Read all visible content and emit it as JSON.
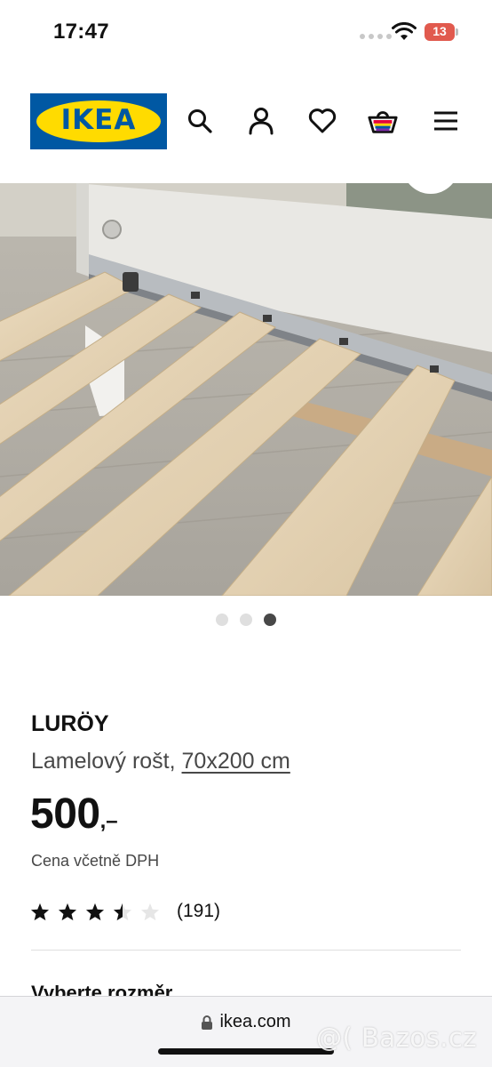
{
  "status_bar": {
    "time": "17:47",
    "battery_level": "13",
    "battery_color": "#e15a4e"
  },
  "header": {
    "logo_text": "IKEA",
    "logo_colors": {
      "background": "#0058a3",
      "oval": "#ffdb00"
    },
    "icons": [
      "search-icon",
      "account-icon",
      "favorites-icon",
      "cart-icon",
      "menu-icon"
    ]
  },
  "gallery": {
    "image_subject": "bed-slats-photo",
    "total_images": 3,
    "active_index": 3
  },
  "product": {
    "name": "LURÖY",
    "description": "Lamelový rošt,",
    "size": "70x200 cm",
    "price": "500",
    "price_suffix": ",–",
    "vat_note": "Cena včetně DPH",
    "rating_value": 3.5,
    "rating_max": 5,
    "review_count": "(191)"
  },
  "next_section": {
    "heading": "Vyberte rozměr"
  },
  "browser": {
    "url": "ikea.com",
    "lock_icon": "lock-icon"
  },
  "watermark": {
    "text": "@( Bazos.cz"
  }
}
